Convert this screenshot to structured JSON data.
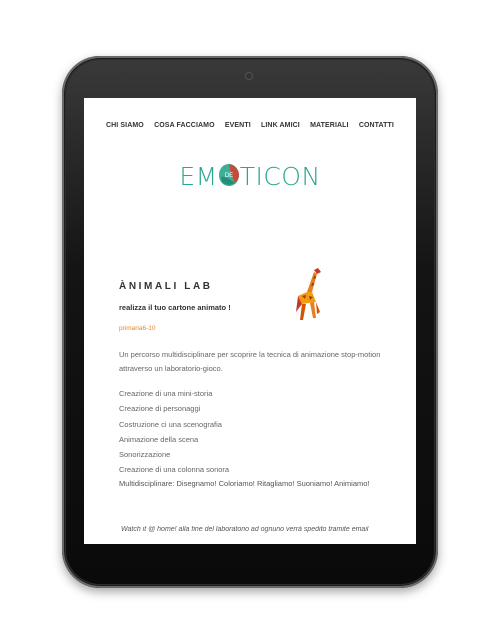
{
  "nav": {
    "items": [
      {
        "label": "CHI SIAMO"
      },
      {
        "label": "COSA FACCIAMO"
      },
      {
        "label": "EVENTI"
      },
      {
        "label": "LINK AMICI"
      },
      {
        "label": "MATERIALI"
      },
      {
        "label": "CONTATTI"
      }
    ]
  },
  "logo": {
    "text_left": "EM",
    "mark_text": "DE",
    "text_right": "TICON",
    "color": "#2aa58e",
    "accent_color": "#d6402e"
  },
  "article": {
    "title": "ÀNIMALI LAB",
    "subtitle": "realizza il tuo cartone animato !",
    "tag": "primaria6-10",
    "tag_color": "#e8862b",
    "description": "Un percorso multidisciplinare per scoprire la tecnica di animazione stop-motion attraverso un laboratorio-gioco.",
    "steps": [
      "Creazione di una mini-storia",
      "Creazione di personaggi",
      "Costruzione ci una scenografia",
      "Animazione della scena",
      "Sonorizzazione",
      "Creazione di una colonna sonora"
    ],
    "multidisciplinary": "Multidisciplinare: Disegnamo! Coloriamo! Ritagliamo! Suoniamo! Animiamo!",
    "watch_note": "Watch it @ home! alla fine del laboratorio ad ognuno verrà spedito tramite email"
  },
  "illustration": {
    "name": "giraffe-icon"
  }
}
